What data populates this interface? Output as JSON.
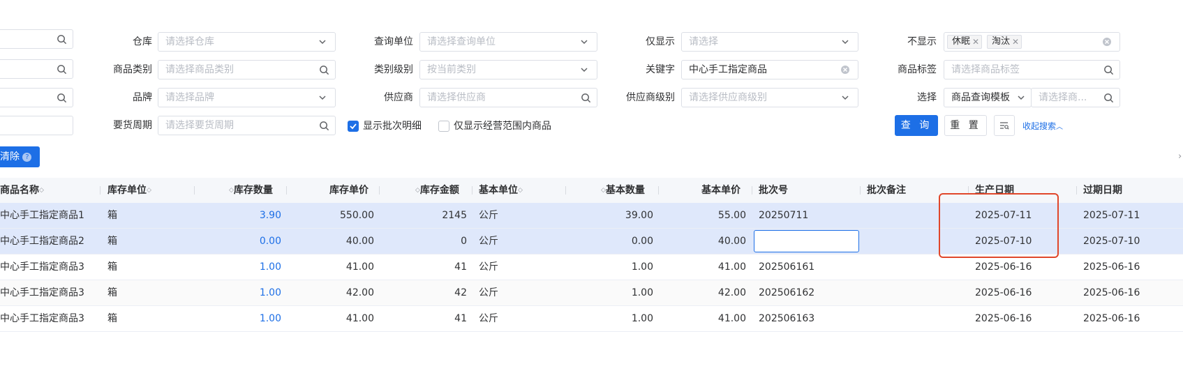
{
  "filters": {
    "warehouse": {
      "label": "仓库",
      "placeholder": "请选择仓库"
    },
    "query_unit": {
      "label": "查询单位",
      "placeholder": "请选择查询单位"
    },
    "only_show": {
      "label": "仅显示",
      "placeholder": "请选择"
    },
    "not_show": {
      "label": "不显示",
      "tags": [
        "休眠",
        "淘汰"
      ]
    },
    "product_category": {
      "label": "商品类别",
      "placeholder": "请选择商品类别"
    },
    "category_level": {
      "label": "类别级别",
      "placeholder": "按当前类别"
    },
    "keyword": {
      "label": "关键字",
      "value": "中心手工指定商品"
    },
    "product_tag": {
      "label": "商品标签",
      "placeholder": "请选择商品标签"
    },
    "brand": {
      "label": "品牌",
      "placeholder": "请选择品牌"
    },
    "supplier": {
      "label": "供应商",
      "placeholder": "请选择供应商"
    },
    "supplier_level": {
      "label": "供应商级别",
      "placeholder": "请选择供应商级别"
    },
    "choose": {
      "label": "选择",
      "template": "商品查询模板",
      "placeholder": "请选择商..."
    },
    "order_cycle": {
      "label": "要货周期",
      "placeholder": "请选择要货周期"
    },
    "show_batch_detail": {
      "label": "显示批次明细",
      "checked": true
    },
    "only_scope": {
      "label": "仅显示经营范围内商品",
      "checked": false
    }
  },
  "actions": {
    "query": "查 询",
    "reset": "重 置",
    "collapse": "收起搜索",
    "clear": "清除"
  },
  "table": {
    "columns": [
      "商品名称",
      "库存单位",
      "库存数量",
      "库存单价",
      "库存金额",
      "基本单位",
      "基本数量",
      "基本单价",
      "批次号",
      "批次备注",
      "生产日期",
      "过期日期"
    ],
    "rows": [
      {
        "name": "中心手工指定商品1",
        "unit": "箱",
        "qty": "3.90",
        "price": "550.00",
        "amount": "2145",
        "base_unit": "公斤",
        "base_qty": "39.00",
        "base_price": "55.00",
        "batch": "20250711",
        "remark": "",
        "mfg": "2025-07-11",
        "exp": "2025-07-11"
      },
      {
        "name": "中心手工指定商品2",
        "unit": "箱",
        "qty": "0.00",
        "price": "40.00",
        "amount": "0",
        "base_unit": "公斤",
        "base_qty": "0.00",
        "base_price": "40.00",
        "batch": "",
        "remark": "",
        "mfg": "2025-07-10",
        "exp": "2025-07-10"
      },
      {
        "name": "中心手工指定商品3",
        "unit": "箱",
        "qty": "1.00",
        "price": "41.00",
        "amount": "41",
        "base_unit": "公斤",
        "base_qty": "1.00",
        "base_price": "41.00",
        "batch": "202506161",
        "remark": "",
        "mfg": "2025-06-16",
        "exp": "2025-06-16"
      },
      {
        "name": "中心手工指定商品3",
        "unit": "箱",
        "qty": "1.00",
        "price": "42.00",
        "amount": "42",
        "base_unit": "公斤",
        "base_qty": "1.00",
        "base_price": "42.00",
        "batch": "202506162",
        "remark": "",
        "mfg": "2025-06-16",
        "exp": "2025-06-16"
      },
      {
        "name": "中心手工指定商品3",
        "unit": "箱",
        "qty": "1.00",
        "price": "41.00",
        "amount": "41",
        "base_unit": "公斤",
        "base_qty": "1.00",
        "base_price": "41.00",
        "batch": "202506163",
        "remark": "",
        "mfg": "2025-06-16",
        "exp": "2025-06-16"
      }
    ]
  },
  "colors": {
    "accent": "#1d6fe6",
    "selected_row": "#dfe8fb",
    "highlight_box": "#e0462a"
  }
}
